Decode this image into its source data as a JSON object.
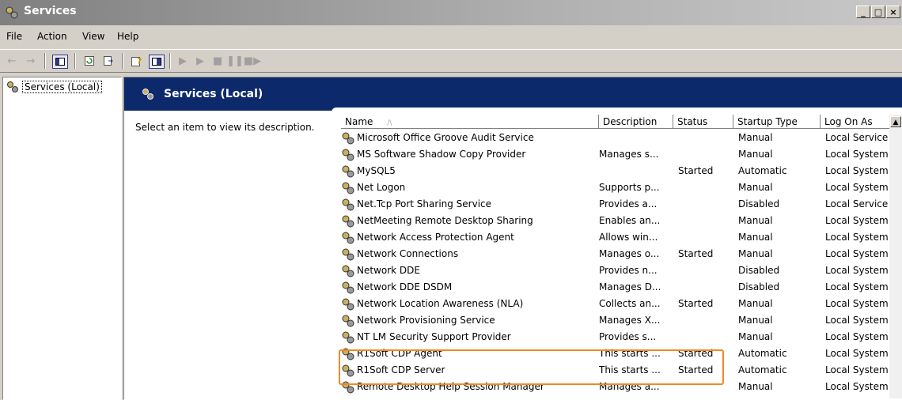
{
  "window": {
    "title": "Services",
    "buttons": [
      "_",
      "□",
      "×"
    ]
  },
  "menu": [
    "File",
    "Action",
    "View",
    "Help"
  ],
  "toolbar": {
    "icons": [
      "back-icon",
      "forward-icon",
      "show-hide-tree-icon",
      "refresh-icon",
      "export-list-icon",
      "help-icon",
      "properties-icon",
      "start-service-icon",
      "start-service-alt-icon",
      "stop-service-icon",
      "pause-service-icon",
      "restart-service-icon"
    ]
  },
  "tree": {
    "item": "Services (Local)"
  },
  "main": {
    "header_title": "Services (Local)",
    "description": "Select an item to view its description."
  },
  "table": {
    "columns": [
      "Name",
      "Description",
      "Status",
      "Startup Type",
      "Log On As"
    ],
    "sort_indicator": "/\\",
    "rows": [
      {
        "name": "Microsoft Office Groove Audit Service",
        "description": "",
        "status": "",
        "startup": "Manual",
        "logon": "Local Service"
      },
      {
        "name": "MS Software Shadow Copy Provider",
        "description": "Manages s...",
        "status": "",
        "startup": "Manual",
        "logon": "Local System"
      },
      {
        "name": "MySQL5",
        "description": "",
        "status": "Started",
        "startup": "Automatic",
        "logon": "Local System"
      },
      {
        "name": "Net Logon",
        "description": "Supports p...",
        "status": "",
        "startup": "Manual",
        "logon": "Local System"
      },
      {
        "name": "Net.Tcp Port Sharing Service",
        "description": "Provides a...",
        "status": "",
        "startup": "Disabled",
        "logon": "Local Service"
      },
      {
        "name": "NetMeeting Remote Desktop Sharing",
        "description": "Enables an...",
        "status": "",
        "startup": "Manual",
        "logon": "Local System"
      },
      {
        "name": "Network Access Protection Agent",
        "description": "Allows win...",
        "status": "",
        "startup": "Manual",
        "logon": "Local System"
      },
      {
        "name": "Network Connections",
        "description": "Manages o...",
        "status": "Started",
        "startup": "Manual",
        "logon": "Local System"
      },
      {
        "name": "Network DDE",
        "description": "Provides n...",
        "status": "",
        "startup": "Disabled",
        "logon": "Local System"
      },
      {
        "name": "Network DDE DSDM",
        "description": "Manages D...",
        "status": "",
        "startup": "Disabled",
        "logon": "Local System"
      },
      {
        "name": "Network Location Awareness (NLA)",
        "description": "Collects an...",
        "status": "Started",
        "startup": "Manual",
        "logon": "Local System"
      },
      {
        "name": "Network Provisioning Service",
        "description": "Manages X...",
        "status": "",
        "startup": "Manual",
        "logon": "Local System"
      },
      {
        "name": "NT LM Security Support Provider",
        "description": "Provides s...",
        "status": "",
        "startup": "Manual",
        "logon": "Local System"
      },
      {
        "name": "R1Soft CDP Agent",
        "description": "This starts ...",
        "status": "Started",
        "startup": "Automatic",
        "logon": "Local System"
      },
      {
        "name": "R1Soft CDP Server",
        "description": "This starts ...",
        "status": "Started",
        "startup": "Automatic",
        "logon": "Local System"
      },
      {
        "name": "Remote Desktop Help Session Manager",
        "description": "Manages a...",
        "status": "",
        "startup": "Manual",
        "logon": "Local System"
      }
    ]
  },
  "colors": {
    "header_band": "#0c2a6b",
    "highlight": "#f08a24",
    "chrome": "#d4d0c8"
  }
}
